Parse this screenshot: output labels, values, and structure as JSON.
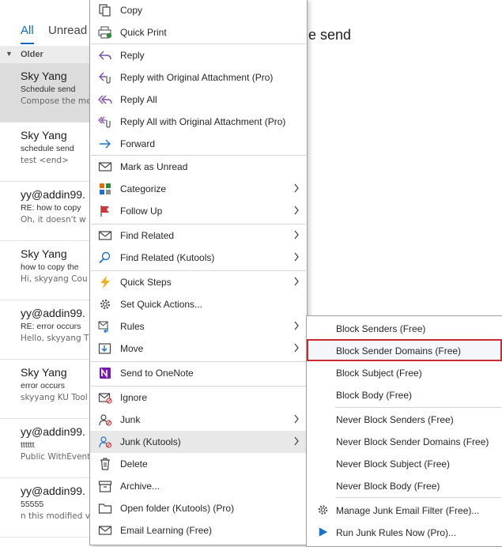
{
  "tabs": {
    "all": "All",
    "unread": "Unread"
  },
  "reading_title_fragment": "le send",
  "list": {
    "group_label": "Older",
    "messages": [
      {
        "from": "Sky Yang",
        "subject": "Schedule send",
        "preview": "Compose the me"
      },
      {
        "from": "Sky Yang",
        "subject": "schedule send",
        "preview": "test <end>"
      },
      {
        "from": "yy@addin99.",
        "subject": "RE: how to copy",
        "preview": "Oh, it doesn't w"
      },
      {
        "from": "Sky Yang",
        "subject": "how to copy the",
        "preview": "Hi, skyyang  Cou"
      },
      {
        "from": "yy@addin99.",
        "subject": "RE: error occurs",
        "preview": "Hello, skyyang  T"
      },
      {
        "from": "Sky Yang",
        "subject": "error occurs",
        "preview": "skyyang  KU Tool"
      },
      {
        "from": "yy@addin99.",
        "subject": "tttttt",
        "preview": "Public WithEvent"
      },
      {
        "from": "yy@addin99.",
        "subject": "55555",
        "preview": "n this modified v"
      }
    ]
  },
  "menu": {
    "items": [
      {
        "label": "Copy",
        "icon": "copy-icon"
      },
      {
        "label": "Quick Print",
        "icon": "quick-print-icon"
      },
      {
        "label": "Reply",
        "icon": "reply-icon"
      },
      {
        "label": "Reply with Original Attachment (Pro)",
        "icon": "reply-attachment-icon"
      },
      {
        "label": "Reply All",
        "icon": "reply-all-icon"
      },
      {
        "label": "Reply All with Original Attachment (Pro)",
        "icon": "reply-all-attachment-icon"
      },
      {
        "label": "Forward",
        "icon": "forward-icon"
      },
      {
        "label": "Mark as Unread",
        "icon": "envelope-icon"
      },
      {
        "label": "Categorize",
        "icon": "categorize-icon"
      },
      {
        "label": "Follow Up",
        "icon": "flag-icon"
      },
      {
        "label": "Find Related",
        "icon": "find-related-icon"
      },
      {
        "label": "Find Related (Kutools)",
        "icon": "search-icon"
      },
      {
        "label": "Quick Steps",
        "icon": "lightning-icon"
      },
      {
        "label": "Set Quick Actions...",
        "icon": "gear-icon"
      },
      {
        "label": "Rules",
        "icon": "rules-icon"
      },
      {
        "label": "Move",
        "icon": "move-icon"
      },
      {
        "label": "Send to OneNote",
        "icon": "onenote-icon"
      },
      {
        "label": "Ignore",
        "icon": "ignore-icon"
      },
      {
        "label": "Junk",
        "icon": "junk-icon"
      },
      {
        "label": "Junk (Kutools)",
        "icon": "junk-kutools-icon"
      },
      {
        "label": "Delete",
        "icon": "trash-icon"
      },
      {
        "label": "Archive...",
        "icon": "archive-icon"
      },
      {
        "label": "Open folder (Kutools) (Pro)",
        "icon": "folder-icon"
      },
      {
        "label": "Email Learning (Free)",
        "icon": "email-learning-icon"
      }
    ]
  },
  "submenu": {
    "items": [
      {
        "label": "Block Senders (Free)"
      },
      {
        "label": "Block Sender Domains (Free)"
      },
      {
        "label": "Block Subject (Free)"
      },
      {
        "label": "Block Body (Free)"
      },
      {
        "label": "Never Block Senders (Free)"
      },
      {
        "label": "Never Block Sender Domains (Free)"
      },
      {
        "label": "Never Block Subject (Free)"
      },
      {
        "label": "Never Block Body (Free)"
      },
      {
        "label": "Manage Junk Email Filter (Free)...",
        "icon": "gear-icon"
      },
      {
        "label": "Run Junk Rules Now (Pro)...",
        "icon": "play-icon"
      }
    ]
  },
  "colors": {
    "accent": "#0f6cbd",
    "highlight_border": "#cc2a33",
    "hover": "#e8e8e8"
  }
}
